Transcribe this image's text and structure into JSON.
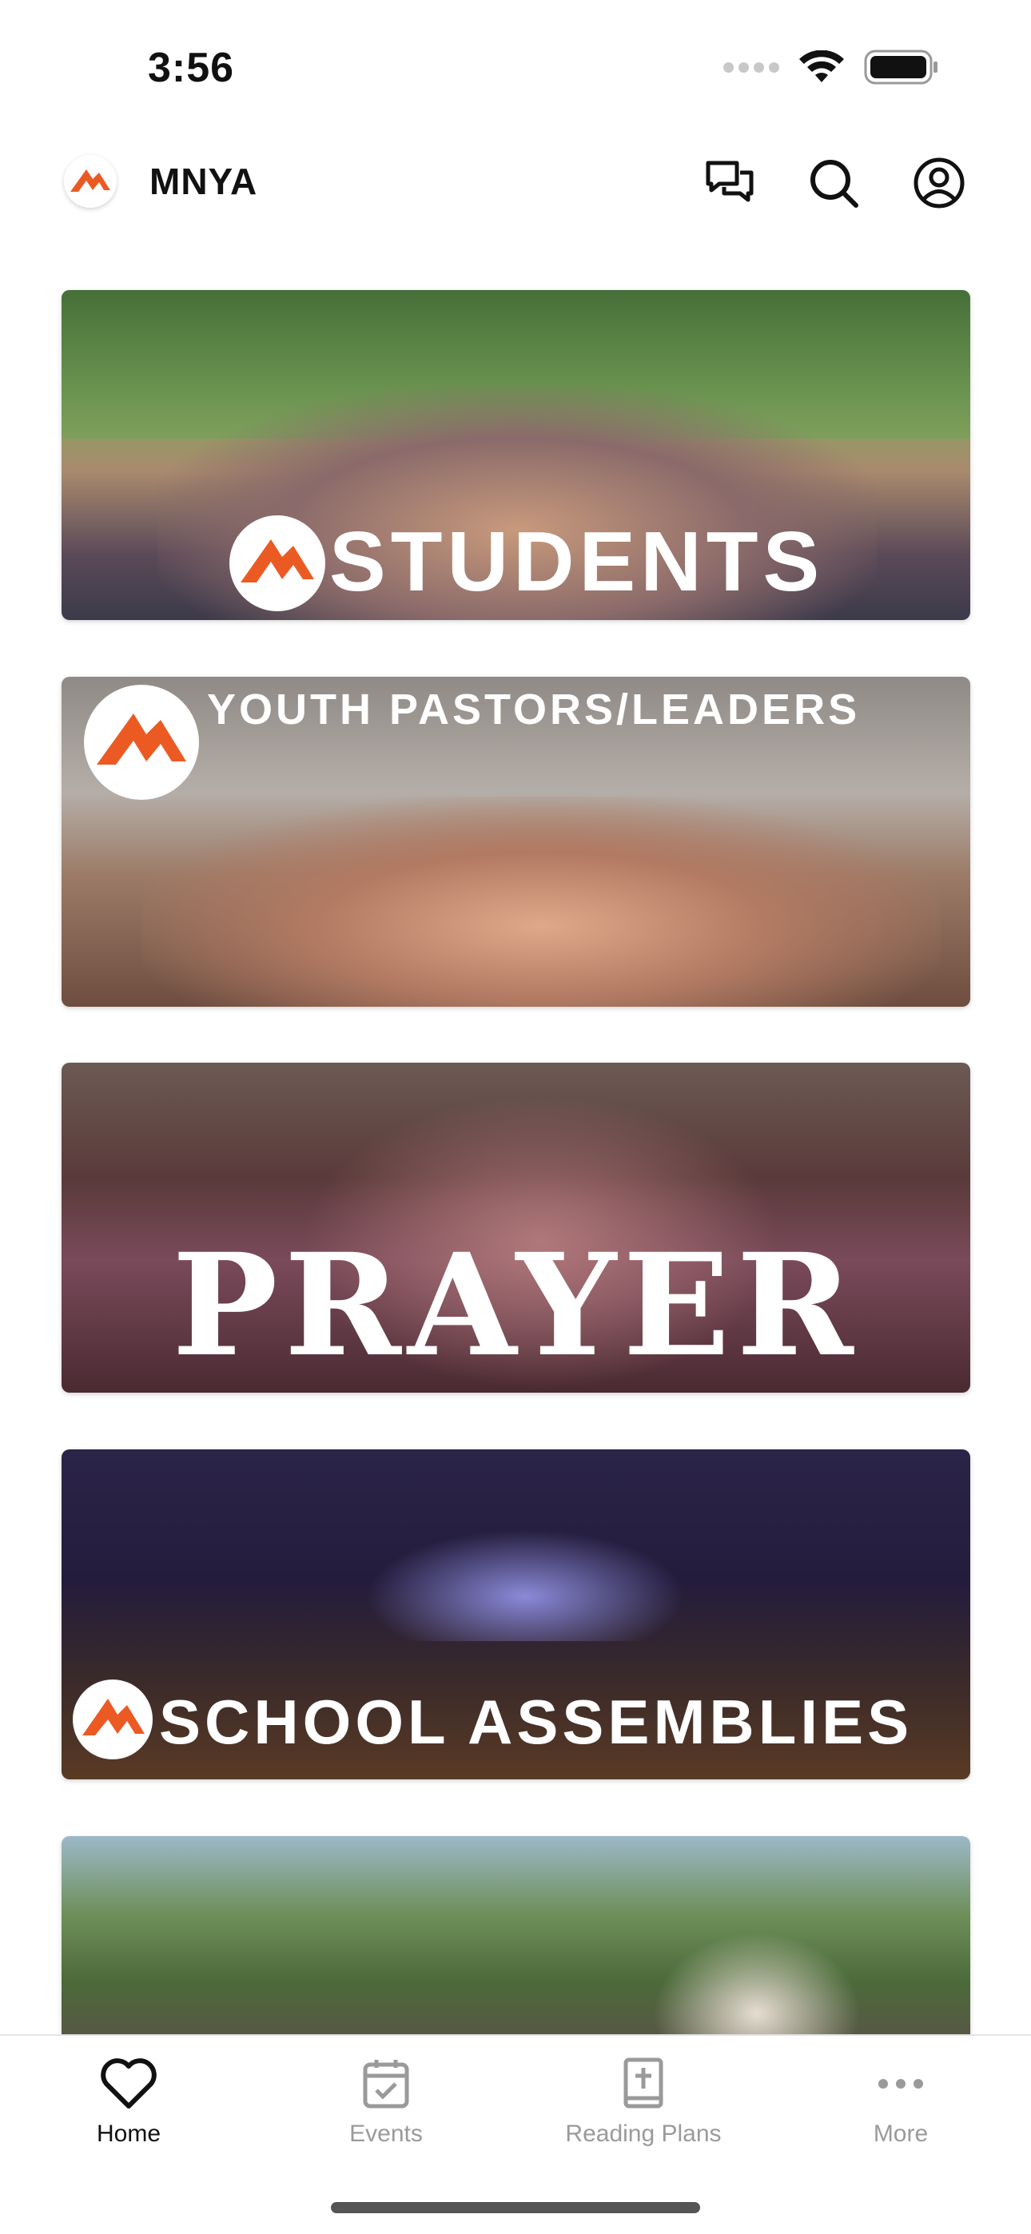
{
  "status_bar": {
    "time": "3:56"
  },
  "header": {
    "app_title": "MNYA"
  },
  "cards": [
    {
      "label": "STUDENTS"
    },
    {
      "label": "YOUTH PASTORS/LEADERS"
    },
    {
      "label": "PRAYER"
    },
    {
      "label": "SCHOOL ASSEMBLIES"
    }
  ],
  "tab_bar": {
    "tabs": [
      {
        "label": "Home",
        "active": true,
        "icon": "heart-icon"
      },
      {
        "label": "Events",
        "active": false,
        "icon": "calendar-check-icon"
      },
      {
        "label": "Reading Plans",
        "active": false,
        "icon": "bible-icon"
      },
      {
        "label": "More",
        "active": false,
        "icon": "ellipsis-icon"
      }
    ]
  },
  "colors": {
    "brand_orange": "#ec5a24",
    "active_tab": "#111111",
    "inactive_tab": "#9a9a9a"
  }
}
